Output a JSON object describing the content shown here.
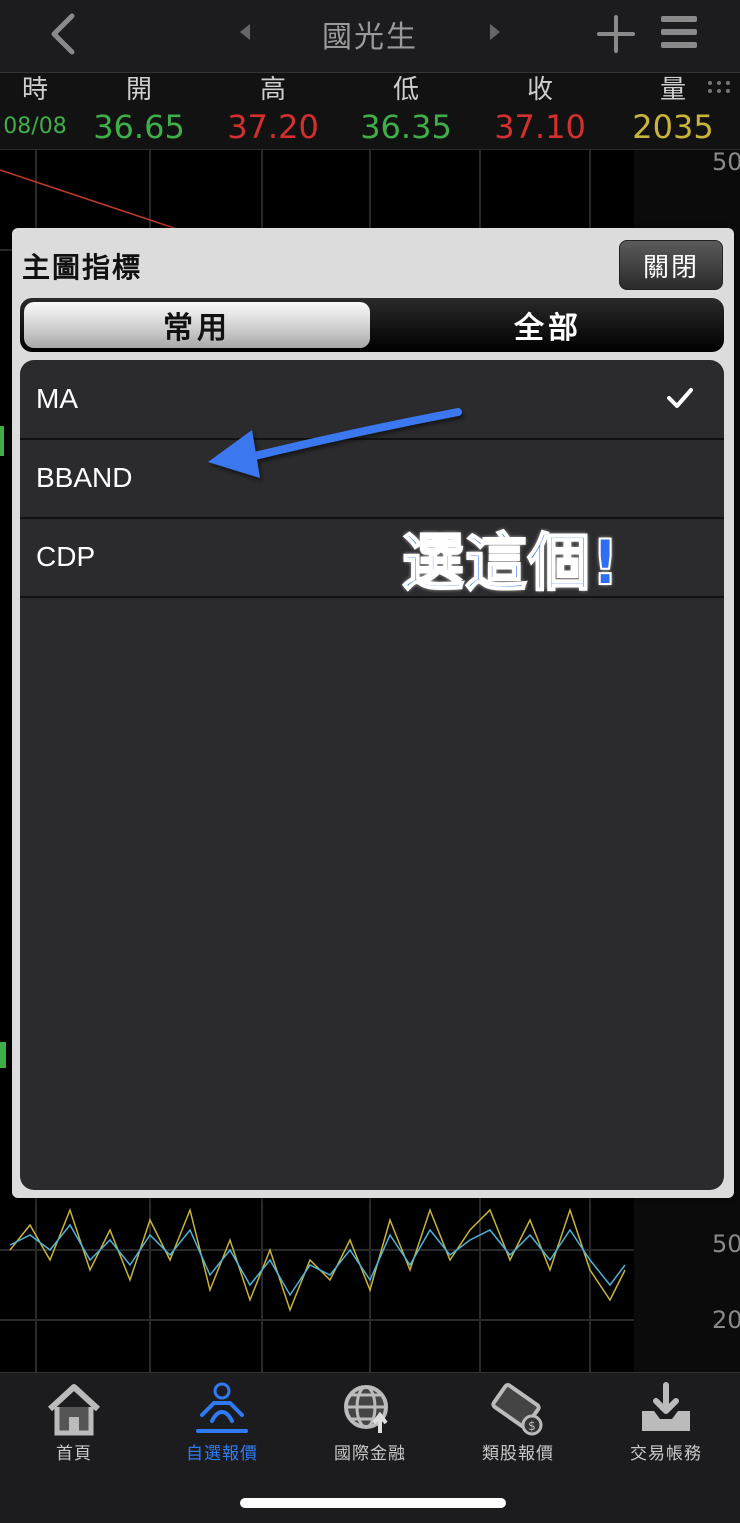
{
  "nav": {
    "title": "國光生"
  },
  "quote": {
    "labels": {
      "time": "時",
      "open": "開",
      "high": "高",
      "low": "低",
      "close": "收",
      "volume": "量"
    },
    "values": {
      "time": "08/08",
      "open": "36.65",
      "high": "37.20",
      "low": "36.35",
      "close": "37.10",
      "volume": "2035"
    },
    "colors": {
      "green": "#3fae49",
      "red": "#d32f2f",
      "yellow": "#c8b43a"
    }
  },
  "chart": {
    "axis_top": "50",
    "axis_mid": "50",
    "axis_bottom": "20"
  },
  "modal": {
    "title": "主圖指標",
    "close_label": "關閉",
    "segments": {
      "common": "常用",
      "all": "全部"
    },
    "items": [
      {
        "label": "MA",
        "checked": true
      },
      {
        "label": "BBAND",
        "checked": false
      },
      {
        "label": "CDP",
        "checked": false
      }
    ]
  },
  "annotation": {
    "text": "選這個!"
  },
  "tabs": [
    {
      "label": "首頁",
      "icon": "home-icon"
    },
    {
      "label": "自選報價",
      "icon": "person-meditating-icon"
    },
    {
      "label": "國際金融",
      "icon": "globe-icon"
    },
    {
      "label": "類股報價",
      "icon": "film-dollar-icon"
    },
    {
      "label": "交易帳務",
      "icon": "download-tray-icon"
    }
  ],
  "active_tab": "自選報價"
}
